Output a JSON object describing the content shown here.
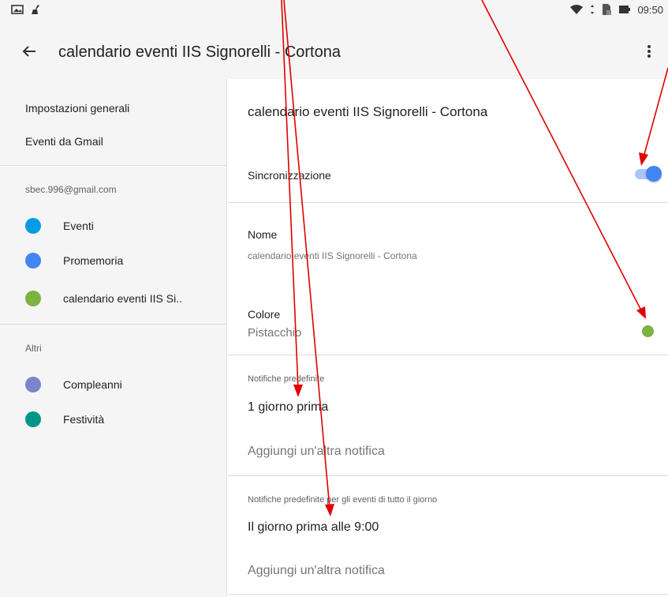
{
  "status_bar": {
    "time": "09:50",
    "icons": [
      "picture-icon",
      "broom-icon",
      "wifi-icon",
      "data-arrows-icon",
      "sim-icon",
      "battery-icon"
    ]
  },
  "app_bar": {
    "title": "calendario eventi IIS Signorelli - Cortona",
    "back_icon": "arrow-left-icon",
    "menu_icon": "more-vert-icon"
  },
  "sidebar": {
    "general_settings": "Impostazioni generali",
    "gmail_events": "Eventi da Gmail",
    "account": "sbec.996@gmail.com",
    "account_calendars": [
      {
        "label": "Eventi",
        "color": "#039be5"
      },
      {
        "label": "Promemoria",
        "color": "#4285f4"
      },
      {
        "label": "calendario eventi IIS Si..",
        "color": "#7cb342"
      }
    ],
    "others_header": "Altri",
    "other_calendars": [
      {
        "label": "Compleanni",
        "color": "#7986cb"
      },
      {
        "label": "Festività",
        "color": "#009688"
      }
    ]
  },
  "main": {
    "title": "calendario eventi IIS Signorelli - Cortona",
    "sync_label": "Sincronizzazione",
    "sync_enabled": true,
    "name_label": "Nome",
    "name_value": "calendario eventi IIS Signorelli - Cortona",
    "color_label": "Colore",
    "color_value": "Pistacchio",
    "color_hex": "#7cb342",
    "default_notifications_header": "Notifiche predefinite",
    "default_notification": "1 giorno prima",
    "add_notification": "Aggiungi un'altra notifica",
    "allday_notifications_header": "Notifiche predefinite per gli eventi di tutto il giorno",
    "allday_notification": "Il giorno prima alle 9:00",
    "add_allday_notification": "Aggiungi un'altra notifica"
  },
  "colors": {
    "accent": "#4285f4",
    "arrow": "#e00000",
    "sidebar_bg": "#f5f5f5"
  }
}
